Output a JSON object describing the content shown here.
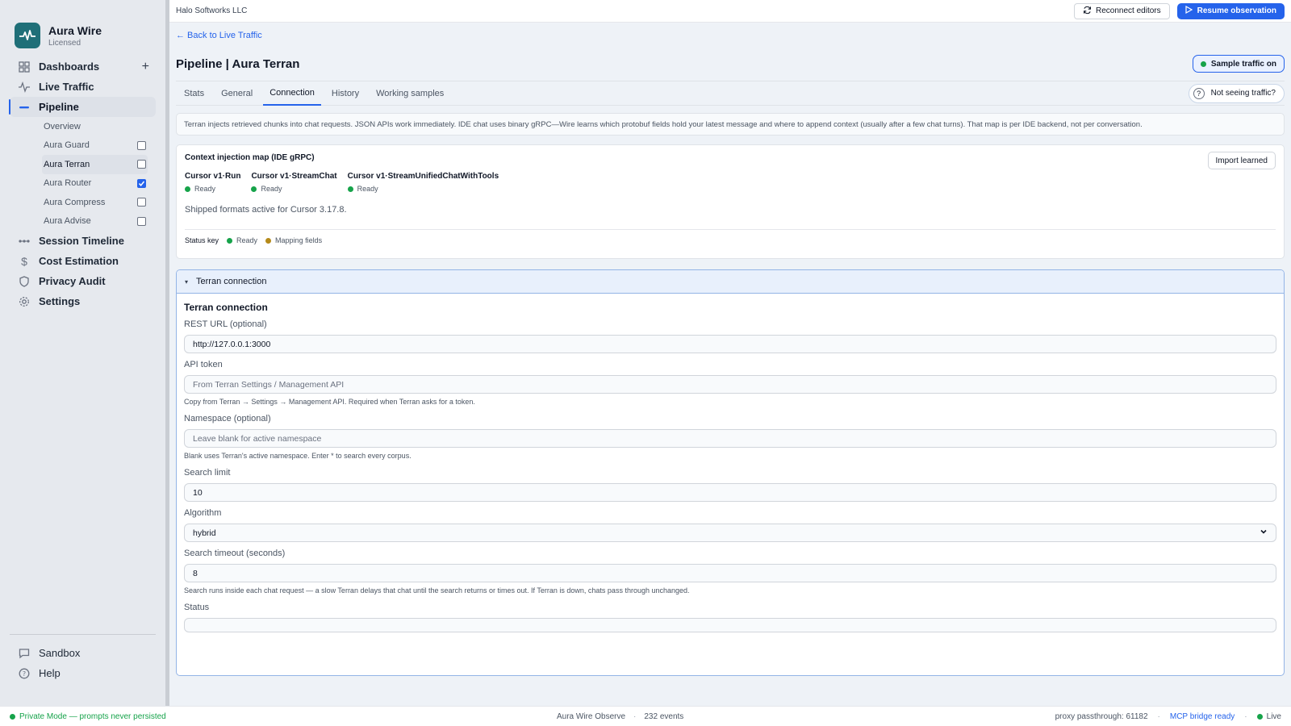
{
  "brand": {
    "name": "Aura Wire",
    "license": "Licensed",
    "accent": "#1f6f78"
  },
  "sidebar": {
    "nav": [
      {
        "label": "Dashboards",
        "icon": "grid-icon"
      },
      {
        "label": "Live Traffic",
        "icon": "activity-icon"
      },
      {
        "label": "Pipeline",
        "icon": "pipeline-icon",
        "active": true
      }
    ],
    "pipeline_items": [
      {
        "label": "Overview",
        "checked": null
      },
      {
        "label": "Aura Guard",
        "checked": false
      },
      {
        "label": "Aura Terran",
        "checked": false,
        "active": true
      },
      {
        "label": "Aura Router",
        "checked": true
      },
      {
        "label": "Aura Compress",
        "checked": false
      },
      {
        "label": "Aura Advise",
        "checked": false
      }
    ],
    "nav2": [
      {
        "label": "Session Timeline",
        "icon": "timeline-icon"
      },
      {
        "label": "Cost Estimation",
        "icon": "dollar-icon"
      },
      {
        "label": "Privacy Audit",
        "icon": "shield-icon"
      },
      {
        "label": "Settings",
        "icon": "gear-icon"
      }
    ],
    "bottom": [
      {
        "label": "Sandbox",
        "icon": "chat-icon"
      },
      {
        "label": "Help",
        "icon": "help-icon"
      }
    ]
  },
  "topbar": {
    "org": "Halo Softworks LLC",
    "reconnect_label": "Reconnect editors",
    "resume_label": "Resume observation"
  },
  "page": {
    "back_label": "← Back to Live Traffic",
    "title": "Pipeline | Aura Terran",
    "sample_traffic_label": "Sample traffic on",
    "help_label": "Not seeing traffic?",
    "tabs": [
      "Stats",
      "General",
      "Connection",
      "History",
      "Working samples"
    ],
    "active_tab": "Connection",
    "info": "Terran injects retrieved chunks into chat requests. JSON APIs work immediately. IDE chat uses binary gRPC—Wire learns which protobuf fields hold your latest message and where to append context (usually after a few chat turns). That map is per IDE backend, not per conversation."
  },
  "context_map": {
    "title": "Context injection map (IDE gRPC)",
    "import_label": "Import learned",
    "formats": [
      {
        "name": "Cursor v1·Run",
        "status": "Ready"
      },
      {
        "name": "Cursor v1·StreamChat",
        "status": "Ready"
      },
      {
        "name": "Cursor v1·StreamUnifiedChatWithTools",
        "status": "Ready"
      }
    ],
    "shipped": "Shipped formats active for Cursor 3.17.8.",
    "status_key_label": "Status key",
    "status_ready": "Ready",
    "status_mapping": "Mapping fields"
  },
  "connection": {
    "accordion_label": "Terran connection",
    "section_title": "Terran connection",
    "rest_url_label": "REST URL (optional)",
    "rest_url_value": "http://127.0.0.1:3000",
    "api_token_label": "API token",
    "api_token_placeholder": "From Terran Settings / Management API",
    "api_token_hint": "Copy from Terran → Settings → Management API. Required when Terran asks for a token.",
    "namespace_label": "Namespace (optional)",
    "namespace_placeholder": "Leave blank for active namespace",
    "namespace_hint": "Blank uses Terran's active namespace. Enter * to search every corpus.",
    "search_limit_label": "Search limit",
    "search_limit_value": "10",
    "algorithm_label": "Algorithm",
    "algorithm_value": "hybrid",
    "timeout_label": "Search timeout (seconds)",
    "timeout_value": "8",
    "timeout_hint": "Search runs inside each chat request — a slow Terran delays that chat until the search returns or times out. If Terran is down, chats pass through unchanged.",
    "status_label": "Status",
    "status_value": ""
  },
  "statusbar": {
    "private_mode": "Private Mode — prompts never persisted",
    "app": "Aura Wire Observe",
    "events": "232 events",
    "proxy": "proxy passthrough: 61182",
    "mcp": "MCP bridge ready",
    "live": "Live"
  },
  "colors": {
    "primary": "#2563eb",
    "ready": "#16a34a",
    "mapping": "#b58a1a"
  }
}
